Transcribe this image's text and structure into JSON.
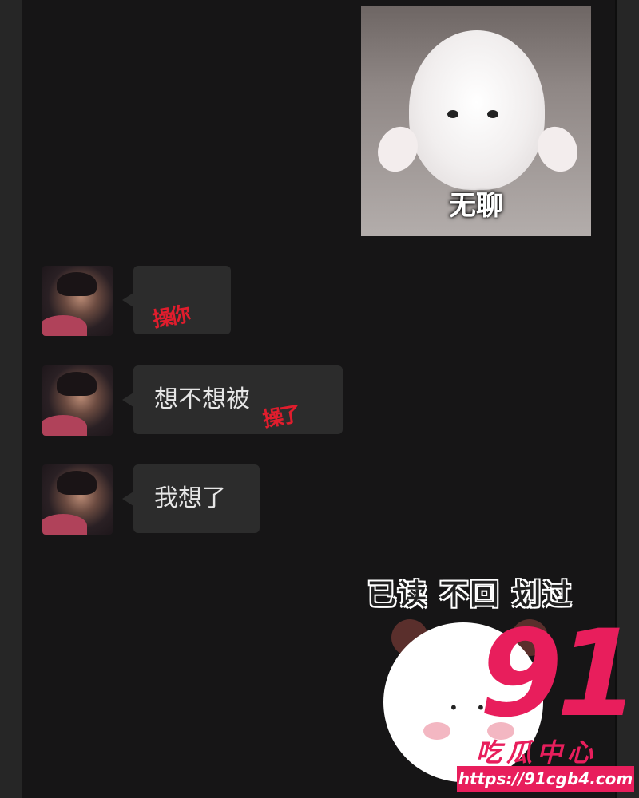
{
  "sticker_cat": {
    "caption": "无聊"
  },
  "messages": [
    {
      "text": "",
      "scribble": "操你"
    },
    {
      "text": "想不想被",
      "scribble": "操了"
    },
    {
      "text": "我想了",
      "scribble": ""
    }
  ],
  "sticker_panda": {
    "caption": "已读 不回 划过"
  },
  "watermark": {
    "logo": "91",
    "subtitle": "吃瓜中心",
    "url": "https://91cgb4.com"
  },
  "colors": {
    "background": "#161516",
    "bubble": "#2c2c2c",
    "accent": "#e81e5c",
    "scribble": "#e01d2d"
  }
}
